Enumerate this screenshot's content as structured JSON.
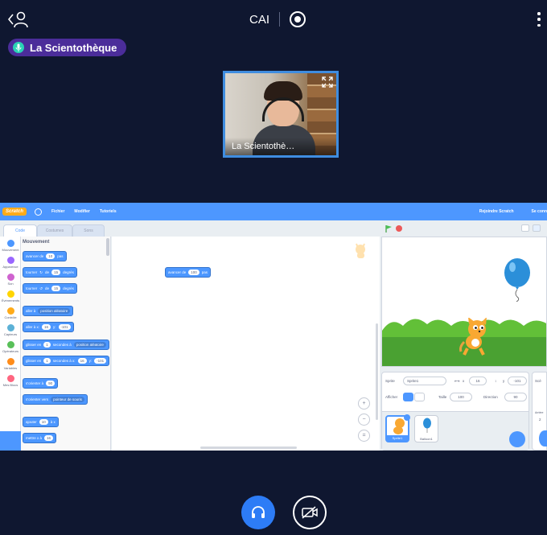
{
  "meeting": {
    "title": "CAI",
    "speaker_name": "La Scientothèque",
    "video_label": "La Scientothè…"
  },
  "icons": {
    "back": "back-profile-icon",
    "record": "record-icon",
    "more": "more-vertical-icon",
    "mic": "microphone-icon",
    "expand": "fullscreen-expand-icon",
    "audio": "headphones-icon",
    "video": "camera-off-icon"
  },
  "colors": {
    "background": "#0f1730",
    "speaker_pill": "#4b2d9a",
    "active_tile_border": "#3f8de0",
    "audio_button": "#2d7cf6",
    "scratch_blue": "#4d97ff"
  },
  "scratch": {
    "logo": "Scratch",
    "menu": {
      "file": "Fichier",
      "edit": "Modifier",
      "tutorials": "Tutoriels",
      "join": "Rejoindre Scratch",
      "signin": "Se conn"
    },
    "tabs": {
      "code": "Code",
      "costumes": "Costumes",
      "sounds": "Sons"
    },
    "categories": [
      {
        "label": "Mouvement",
        "color": "#4c97ff"
      },
      {
        "label": "Apparence",
        "color": "#9966ff"
      },
      {
        "label": "Son",
        "color": "#cf63cf"
      },
      {
        "label": "Événements",
        "color": "#ffd500"
      },
      {
        "label": "Contrôle",
        "color": "#ffab19"
      },
      {
        "label": "Capteurs",
        "color": "#5cb1d6"
      },
      {
        "label": "Opérateurs",
        "color": "#59c059"
      },
      {
        "label": "Variables",
        "color": "#ff8c1a"
      },
      {
        "label": "Mes Blocs",
        "color": "#ff6680"
      }
    ],
    "palette_title": "Mouvement",
    "blocks": {
      "move": {
        "text": "avancer de",
        "value": "10",
        "suffix": "pas"
      },
      "turn_right": {
        "text": "tourner",
        "mid": "de",
        "value": "15",
        "suffix": "degrés"
      },
      "turn_left": {
        "text": "tourner",
        "mid": "de",
        "value": "15",
        "suffix": "degrés"
      },
      "goto": {
        "text": "aller à",
        "value": "position aléatoire"
      },
      "goto_xy": {
        "text": "aller à x:",
        "x": "16",
        "y_label": "y:",
        "y": "-101"
      },
      "glide_to": {
        "text": "glisser en",
        "value": "1",
        "mid": "secondes à",
        "target": "position aléatoire"
      },
      "glide_xy": {
        "text": "glisser en",
        "value": "1",
        "mid": "secondes à x:",
        "x": "16",
        "y_label": "y:",
        "y": "-101"
      },
      "point_dir": {
        "text": "s'orienter à",
        "value": "90"
      },
      "point_towards": {
        "text": "s'orienter vers",
        "value": "pointeur de souris"
      },
      "change_x": {
        "text": "ajouter",
        "value": "10",
        "suffix": "à x"
      },
      "set_x": {
        "text": "mettre x à",
        "value": "16"
      }
    },
    "script_block": {
      "text": "avancer de",
      "value": "100",
      "suffix": "pas"
    },
    "zoom": {
      "in": "+",
      "out": "−",
      "reset": "="
    },
    "sprite_info": {
      "sprite_label": "Sprite",
      "sprite_name": "Sprite1",
      "x_label": "x",
      "x": "16",
      "y_label": "y",
      "y": "-101",
      "show_label": "Afficher",
      "size_label": "Taille",
      "size": "100",
      "direction_label": "Direction",
      "direction": "90"
    },
    "sprites": [
      "Sprite1",
      "Balloon1"
    ],
    "stage_panel": {
      "label_1": "Scè",
      "label_2": "Arrière",
      "count": "2"
    }
  }
}
